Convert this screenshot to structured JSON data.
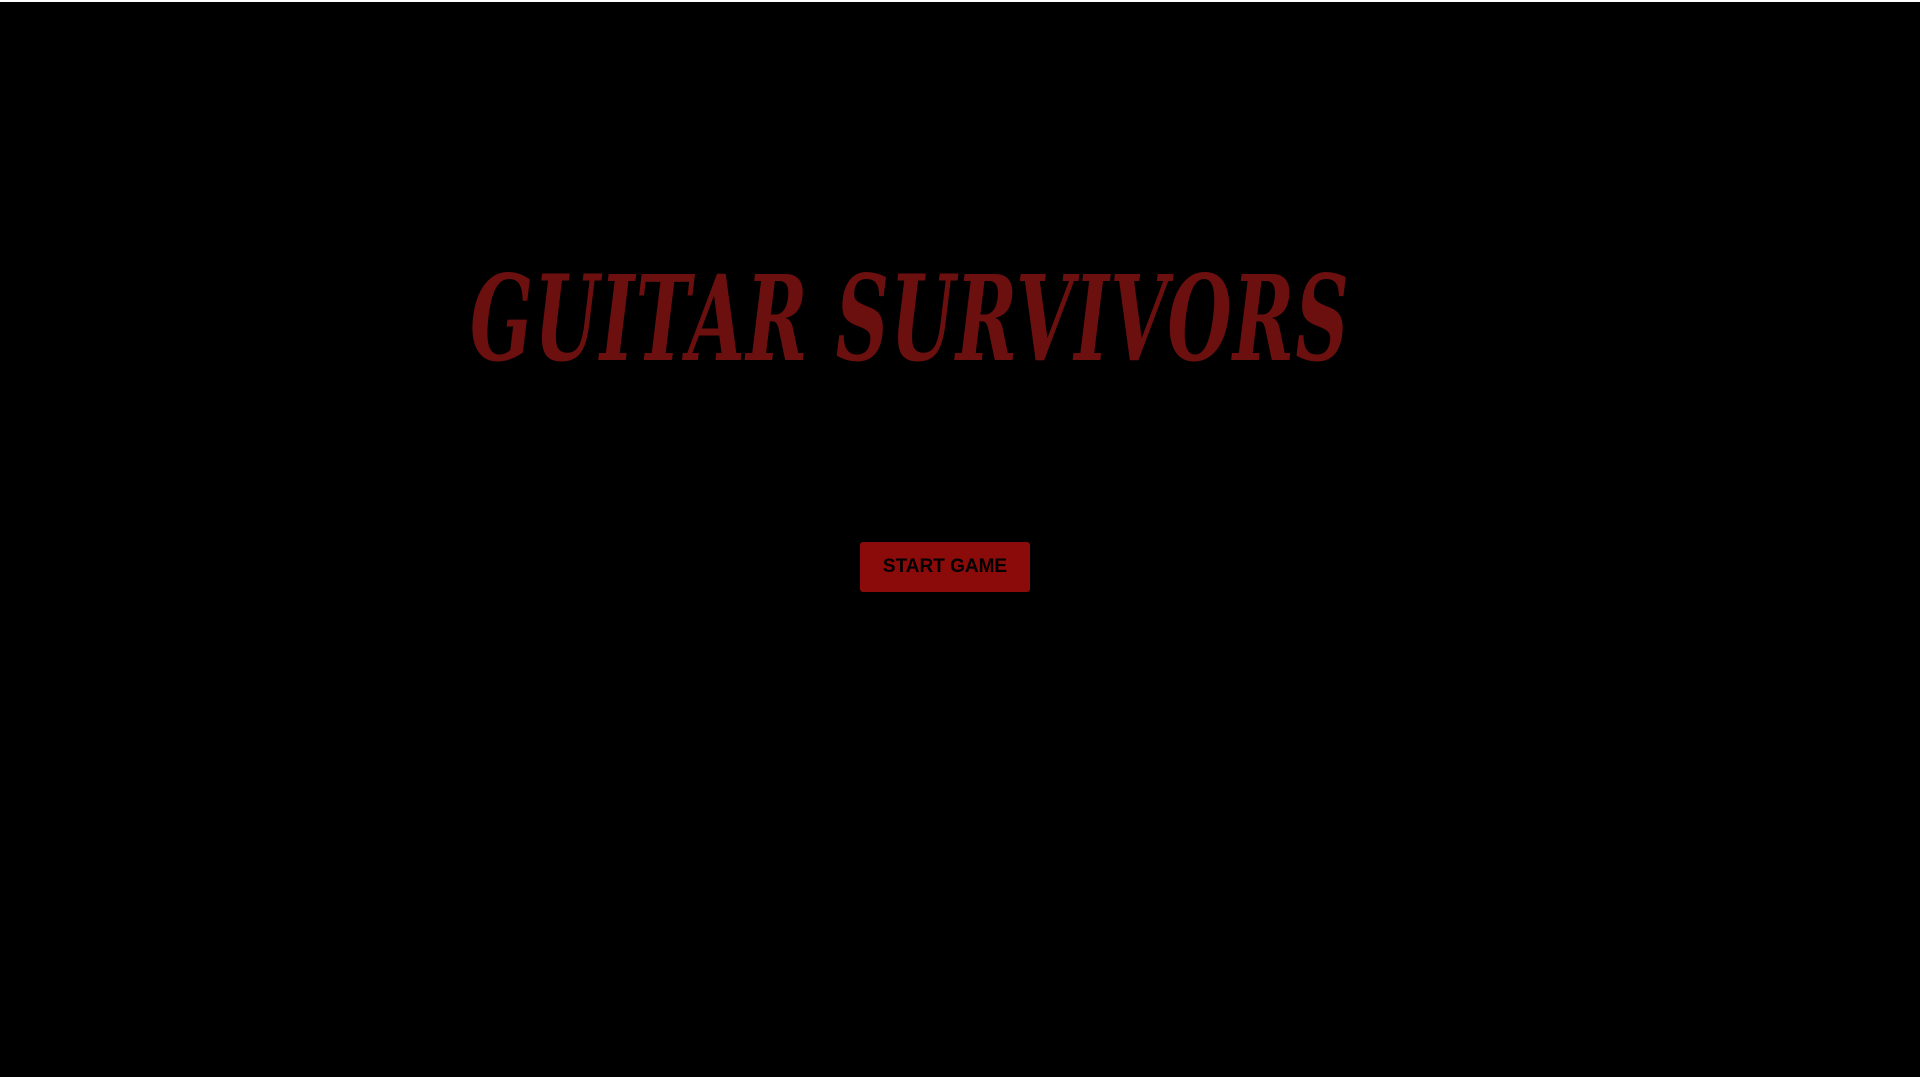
{
  "game": {
    "title": "GUITAR SURVIVORS",
    "start_label": "START GAME"
  },
  "colors": {
    "background": "#000000",
    "title": "#6b0f0f",
    "button": "#8b0a0a",
    "button_text": "#000000"
  }
}
